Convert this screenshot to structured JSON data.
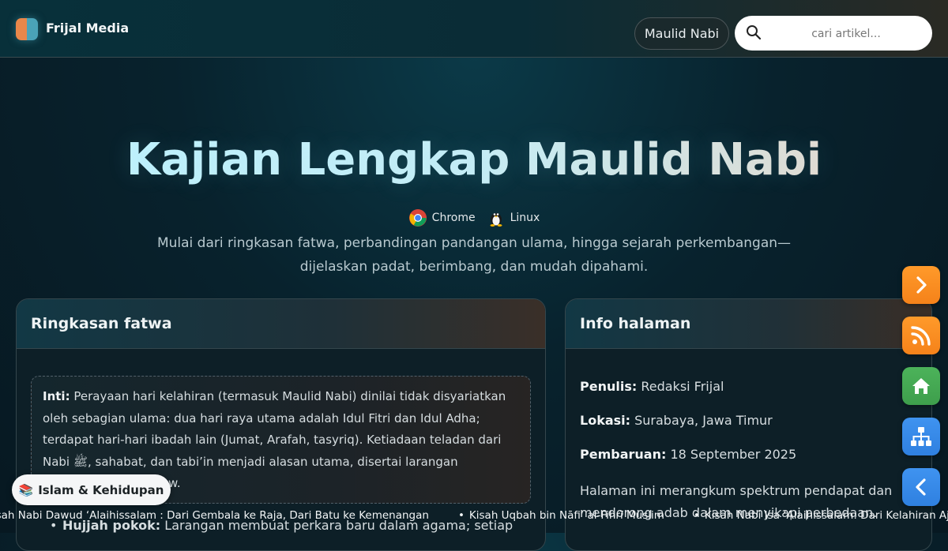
{
  "site": {
    "name": "Frijal Media"
  },
  "nav": {
    "pill_label": "Maulid Nabi",
    "search_placeholder": "cari artikel..."
  },
  "hero": {
    "title": "Kajian Lengkap Maulid Nabi",
    "browsers": [
      {
        "label": "Chrome",
        "icon": "chrome-icon"
      },
      {
        "label": "Linux",
        "icon": "linux-icon"
      }
    ],
    "subtitle_line1": "Mulai dari ringkasan fatwa, perbandingan pandangan ulama, hingga sejarah perkembangan—",
    "subtitle_line2": "dijelaskan padat, berimbang, dan mudah dipahami."
  },
  "fatwa_card": {
    "title": "Ringkasan fatwa",
    "core_label": "Inti:",
    "core_text": "Perayaan hari kelahiran (termasuk Maulid Nabi) dinilai tidak disyariatkan oleh sebagian ulama: dua hari raya utama adalah Idul Fitri dan Idul Adha; terdapat hari-hari ibadah lain (Jumat, Arafah, tasyriq). Ketiadaan teladan dari Nabi ﷺ, sahabat, dan tabi’in menjadi alasan utama, disertai larangan tasyabbuh dan ghuluw.",
    "bullet_label": "Hujjah pokok:",
    "bullet_text": "Larangan membuat perkara baru dalam agama; setiap"
  },
  "info_card": {
    "title": "Info halaman",
    "author_label": "Penulis:",
    "author_value": "Redaksi Frijal",
    "location_label": "Lokasi:",
    "location_value": "Surabaya, Jawa Timur",
    "updated_label": "Pembaruan:",
    "updated_value": "18 September 2025",
    "paragraph": "Halaman ini merangkum spektrum pendapat dan mendorong adab dalam menyikapi perbedaan."
  },
  "fabs": [
    {
      "name": "next-button",
      "icon": "chevron-right-icon",
      "color": "#f5821a"
    },
    {
      "name": "rss-button",
      "icon": "rss-icon",
      "color": "#f5821a"
    },
    {
      "name": "home-button",
      "icon": "home-icon",
      "color": "#3e9e4c"
    },
    {
      "name": "sitemap-button",
      "icon": "sitemap-icon",
      "color": "#2f80e0"
    },
    {
      "name": "back-button",
      "icon": "chevron-left-icon",
      "color": "#2f80e0"
    }
  ],
  "category_chip": {
    "emoji": "📚",
    "label": "Islam & Kehidupan"
  },
  "ticker": {
    "items": [
      "Kisah Nabi Dawud ‘Alaihissalam : Dari Gembala ke Raja, Dari Batu ke Kemenangan",
      "Kisah Uqbah bin Nāfi‘ al-Fihrī Muslim",
      "Kisah Nabi Isa ‘Alaihissalam: Dari Kelahiran Ajaib Sampai"
    ]
  }
}
